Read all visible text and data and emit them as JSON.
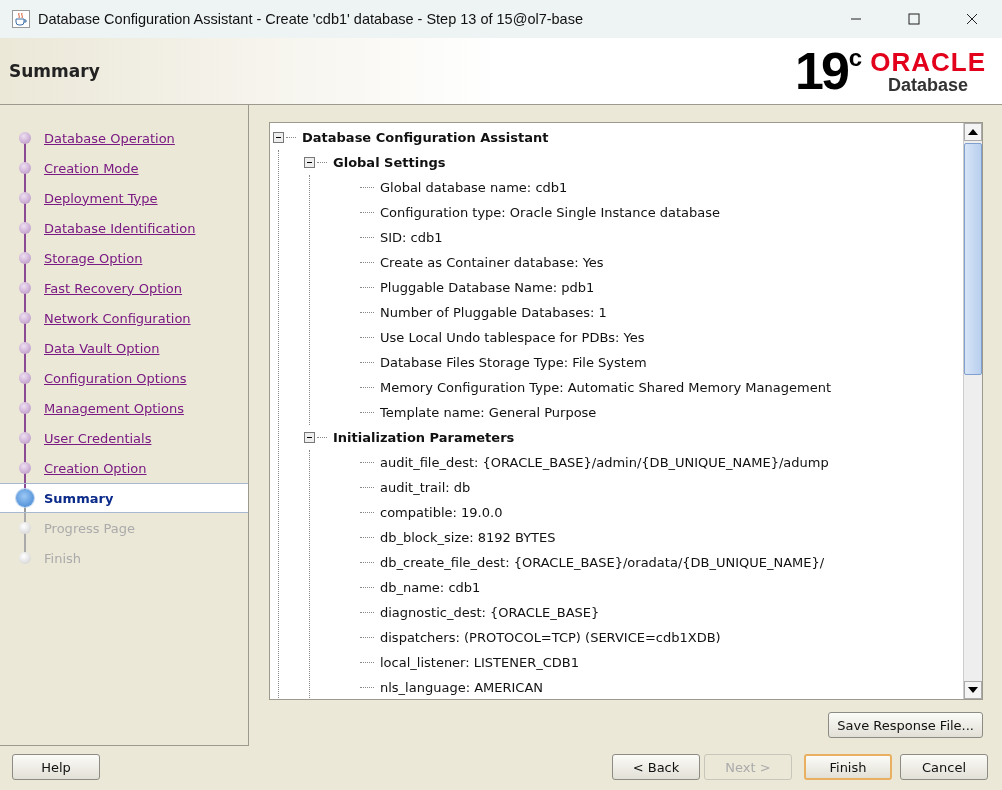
{
  "window": {
    "title": "Database Configuration Assistant - Create 'cdb1' database - Step 13 of 15@ol7-base"
  },
  "header": {
    "title": "Summary",
    "logo": {
      "version": "19",
      "suffix": "c",
      "brand": "ORACLE",
      "product": "Database"
    }
  },
  "steps": [
    {
      "label": "Database Operation",
      "kind": "done",
      "selected": false
    },
    {
      "label": "Creation Mode",
      "kind": "done",
      "selected": false
    },
    {
      "label": "Deployment Type",
      "kind": "done",
      "selected": false
    },
    {
      "label": "Database Identification",
      "kind": "done",
      "selected": false
    },
    {
      "label": "Storage Option",
      "kind": "done",
      "selected": false
    },
    {
      "label": "Fast Recovery Option",
      "kind": "done",
      "selected": false
    },
    {
      "label": "Network Configuration",
      "kind": "done",
      "selected": false
    },
    {
      "label": "Data Vault Option",
      "kind": "done",
      "selected": false
    },
    {
      "label": "Configuration Options",
      "kind": "done",
      "selected": false
    },
    {
      "label": "Management Options",
      "kind": "done",
      "selected": false
    },
    {
      "label": "User Credentials",
      "kind": "done",
      "selected": false
    },
    {
      "label": "Creation Option",
      "kind": "done",
      "selected": false
    },
    {
      "label": "Summary",
      "kind": "current",
      "selected": true
    },
    {
      "label": "Progress Page",
      "kind": "pending",
      "selected": false
    },
    {
      "label": "Finish",
      "kind": "pending",
      "selected": false
    }
  ],
  "tree": {
    "label": "Database Configuration Assistant",
    "expanded": true,
    "children": [
      {
        "label": "Global Settings",
        "expanded": true,
        "children": [
          {
            "label": "Global database name: cdb1"
          },
          {
            "label": "Configuration type: Oracle Single Instance database"
          },
          {
            "label": "SID: cdb1"
          },
          {
            "label": "Create as Container database: Yes"
          },
          {
            "label": "Pluggable Database Name: pdb1"
          },
          {
            "label": "Number of Pluggable Databases: 1"
          },
          {
            "label": "Use Local Undo tablespace for PDBs: Yes"
          },
          {
            "label": "Database Files Storage Type: File System"
          },
          {
            "label": "Memory Configuration Type: Automatic Shared Memory Management"
          },
          {
            "label": "Template name: General Purpose"
          }
        ]
      },
      {
        "label": "Initialization Parameters",
        "expanded": true,
        "children": [
          {
            "label": "audit_file_dest: {ORACLE_BASE}/admin/{DB_UNIQUE_NAME}/adump"
          },
          {
            "label": "audit_trail: db"
          },
          {
            "label": "compatible: 19.0.0"
          },
          {
            "label": "db_block_size: 8192 BYTES"
          },
          {
            "label": "db_create_file_dest: {ORACLE_BASE}/oradata/{DB_UNIQUE_NAME}/"
          },
          {
            "label": "db_name: cdb1"
          },
          {
            "label": "diagnostic_dest: {ORACLE_BASE}"
          },
          {
            "label": "dispatchers: (PROTOCOL=TCP) (SERVICE=cdb1XDB)"
          },
          {
            "label": "local_listener: LISTENER_CDB1"
          },
          {
            "label": "nls_language: AMERICAN"
          }
        ]
      }
    ]
  },
  "save_button": {
    "label": "Save Response File..."
  },
  "buttons": [
    {
      "label": "Help",
      "kind": "left",
      "disabled": false,
      "default": false
    },
    {
      "label": "< Back",
      "kind": "right",
      "disabled": false,
      "default": false
    },
    {
      "label": "Next >",
      "kind": "right",
      "disabled": true,
      "default": false
    },
    {
      "label": "Finish",
      "kind": "right",
      "disabled": false,
      "default": true
    },
    {
      "label": "Cancel",
      "kind": "right",
      "disabled": false,
      "default": false
    }
  ]
}
